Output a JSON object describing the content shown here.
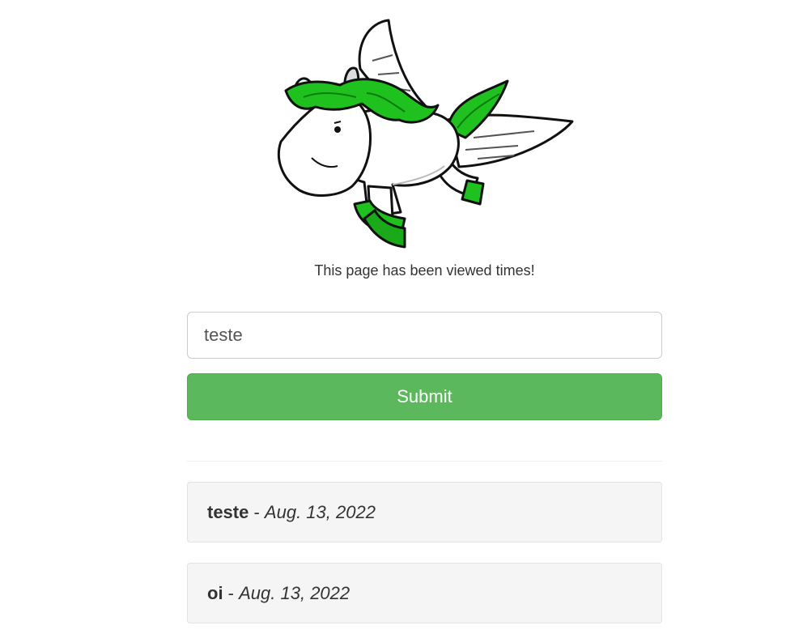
{
  "header": {
    "logo_icon": "green-maned-pegasus-unicorn-icon",
    "views_text": "This page has been viewed times!"
  },
  "form": {
    "input_value": "teste",
    "submit_label": "Submit"
  },
  "messages": [
    {
      "text": "teste",
      "separator": " - ",
      "date": "Aug. 13, 2022"
    },
    {
      "text": "oi",
      "separator": " - ",
      "date": "Aug. 13, 2022"
    }
  ],
  "colors": {
    "accent_green": "#5cb85c",
    "mane_green": "#1fc11f",
    "card_background": "#f5f5f5"
  }
}
